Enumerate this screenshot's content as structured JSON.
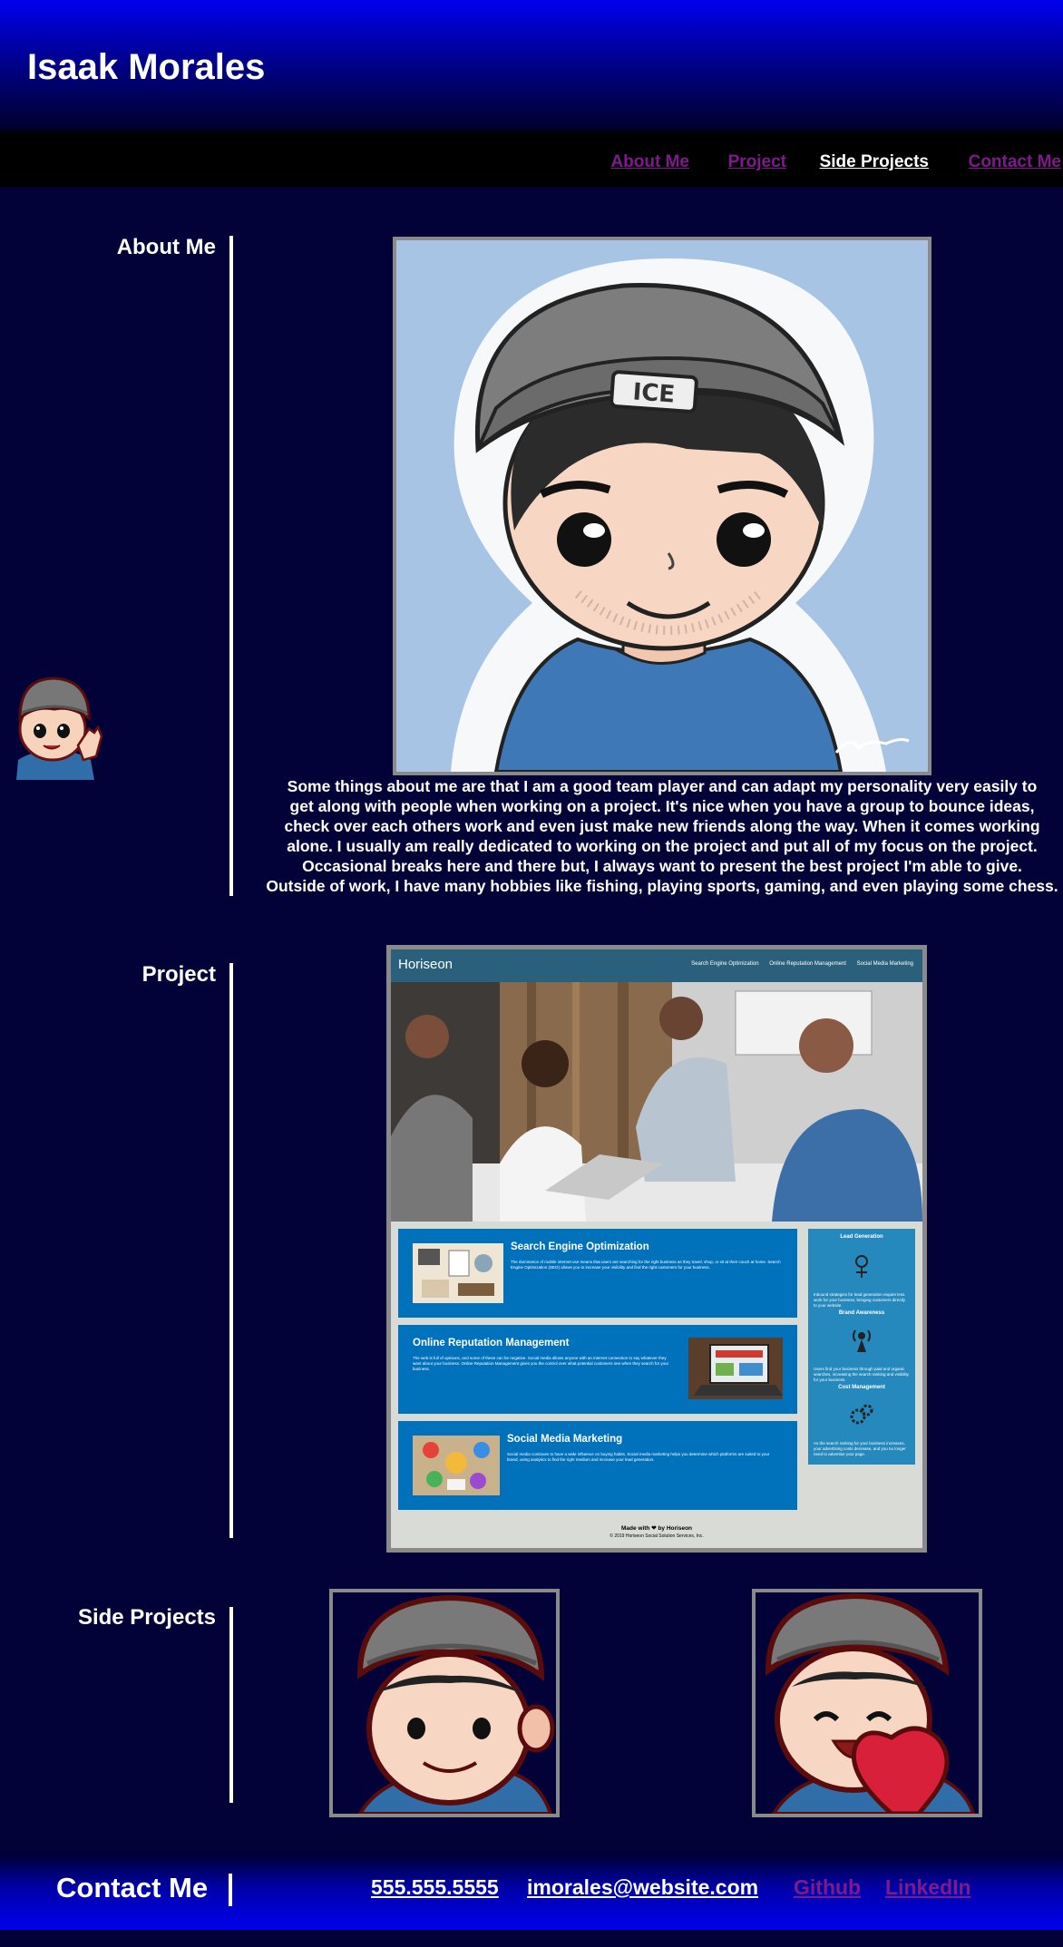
{
  "header": {
    "brand": "Isaak Morales",
    "nav": [
      "About Me",
      "Project",
      "Side Projects",
      "Contact Me"
    ]
  },
  "about": {
    "title": "About Me",
    "lines": [
      "Some things about me are that I am a good team player and can adapt my personality very easily to",
      "get along with people when working on a project. It's nice when you have a group to bounce ideas,",
      "check over each others work and even just make new friends along the way. When it comes working",
      "alone. I usually am really dedicated to working on the project and put all of my focus on the project.",
      "Occasional breaks here and there but, I always want to present the best project I'm able to give.",
      "Outside of work, I have many hobbies like fishing, playing sports, gaming, and even playing some chess."
    ],
    "avatar_badge": "ICE"
  },
  "project": {
    "title": "Project",
    "mockup": {
      "logo": "Horiseon",
      "nav": [
        "Search Engine Optimization",
        "Online Reputation Management",
        "Social Media Marketing"
      ],
      "cards": [
        {
          "title": "Search Engine Optimization",
          "text": "The dominance of mobile internet use means that users are searching for the right business as they travel, shop, or sit at their couch at home. Search Engine Optimization (SEO) allows you to increase your visibility and find the right customers for your business."
        },
        {
          "title": "Online Reputation Management",
          "text": "The web is full of opinions, and some of these can be negative. Social media allows anyone with an internet connection to say whatever they want about your business. Online Reputation Management gives you the control over what potential customers see when they search for your business."
        },
        {
          "title": "Social Media Marketing",
          "text": "Social media continues to have a wide influence on buying habits. Social media marketing helps you determine which platforms are suited to your brand, using analytics to find the right medium and increase your lead generation."
        }
      ],
      "side": [
        {
          "title": "Lead Generation",
          "text": "Inbound strategies for lead generation require less work for your business, bringing customers directly to your website."
        },
        {
          "title": "Brand Awareness",
          "text": "Users find your business through paid and organic searches, increasing the search ranking and visibility for your business."
        },
        {
          "title": "Cost Management",
          "text": "As the search ranking for your business increases, your advertising costs decrease, and you no longer need to advertise your page."
        }
      ],
      "footer": "Made with ❤ by Horiseon",
      "copyright": "© 2019 Horiseon Social Solution Services, Inc."
    }
  },
  "side_projects": {
    "title": "Side Projects"
  },
  "contact": {
    "title": "Contact Me",
    "phone": "555.555.5555",
    "email": "imorales@website.com",
    "github": "Github",
    "linkedin": "LinkedIn"
  }
}
